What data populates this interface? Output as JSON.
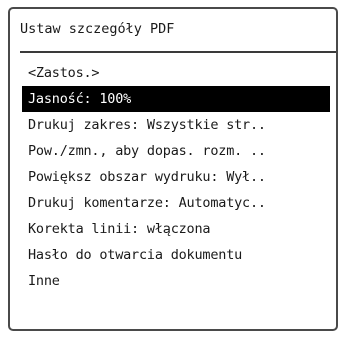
{
  "screen": {
    "title": "Ustaw szczegóły PDF"
  },
  "menu": {
    "selected_index": 1,
    "items": [
      {
        "label": "<Zastos.>"
      },
      {
        "label": "Jasność: 100%"
      },
      {
        "label": "Drukuj zakres: Wszystkie str.."
      },
      {
        "label": "Pow./zmn., aby dopas. rozm. .."
      },
      {
        "label": "Powiększ obszar wydruku: Wył.."
      },
      {
        "label": "Drukuj komentarze: Automatyc.."
      },
      {
        "label": "Korekta linii: włączona"
      },
      {
        "label": "Hasło do otwarcia dokumentu"
      },
      {
        "label": "Inne"
      }
    ]
  },
  "colors": {
    "selected_background": "#000000",
    "selected_text": "#ffffff",
    "text": "#1a1a1a",
    "border": "#4a4a4a"
  }
}
